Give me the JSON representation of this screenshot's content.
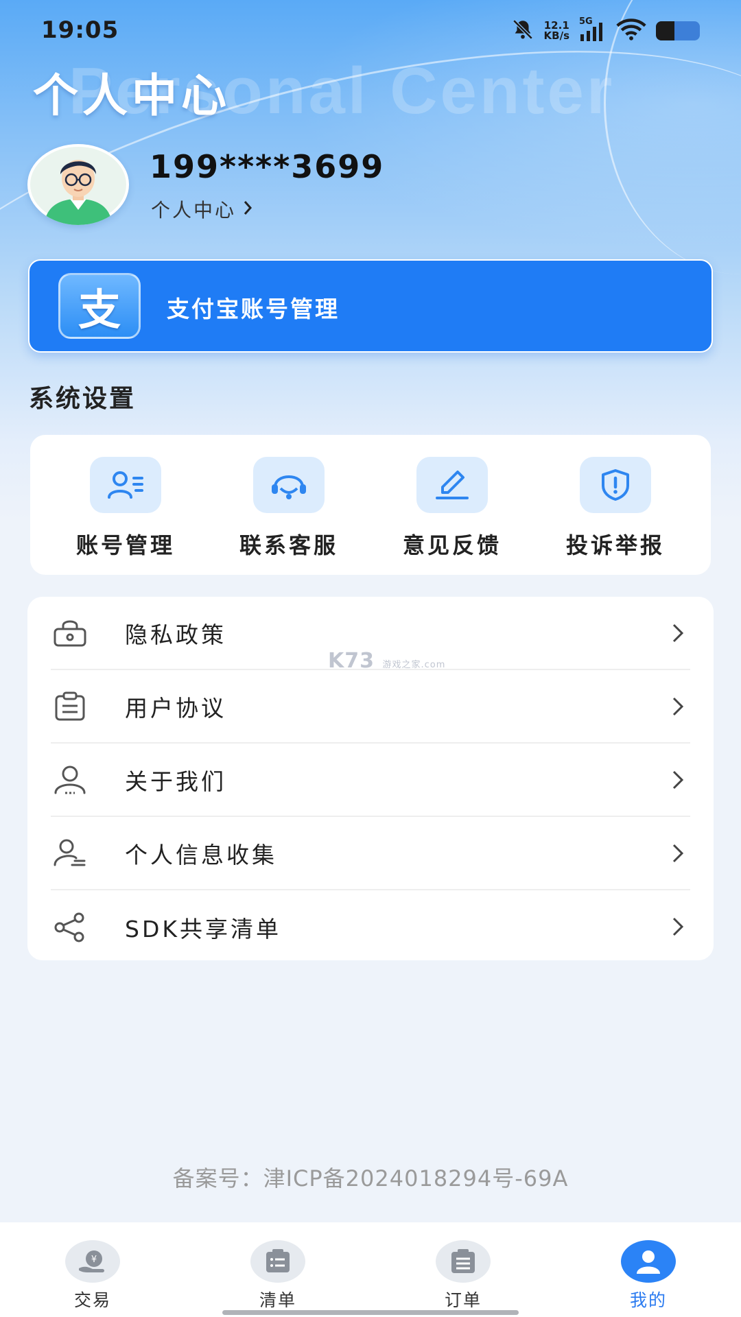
{
  "status_bar": {
    "time": "19:05",
    "net_speed_value": "12.1",
    "net_speed_unit": "KB/s",
    "network": "5G",
    "icons": [
      "bell-muted-icon",
      "signal-icon",
      "wifi-icon",
      "battery-icon"
    ],
    "battery_level": 0.42
  },
  "header": {
    "title": "个人中心",
    "watermark": "Personal Center"
  },
  "profile": {
    "phone": "199****3699",
    "link_label": "个人中心"
  },
  "alipay": {
    "label": "支付宝账号管理",
    "icon_char": "支"
  },
  "settings": {
    "section_title": "系统设置",
    "items": [
      {
        "label": "账号管理",
        "icon": "account-manage-icon"
      },
      {
        "label": "联系客服",
        "icon": "headset-icon"
      },
      {
        "label": "意见反馈",
        "icon": "pen-icon"
      },
      {
        "label": "投诉举报",
        "icon": "shield-alert-icon"
      }
    ]
  },
  "menu": {
    "items": [
      {
        "label": "隐私政策",
        "icon": "lock-icon"
      },
      {
        "label": "用户协议",
        "icon": "clipboard-icon"
      },
      {
        "label": "关于我们",
        "icon": "user-group-icon"
      },
      {
        "label": "个人信息收集",
        "icon": "user-info-icon"
      },
      {
        "label": "SDK共享清单",
        "icon": "share-icon"
      }
    ]
  },
  "watermark_overlay": {
    "brand": "K73",
    "line1": "游戏之家",
    "line2": ".com"
  },
  "footer": {
    "icp": "备案号：津ICP备2024018294号-69A"
  },
  "tabbar": {
    "tabs": [
      {
        "label": "交易",
        "icon": "trade-icon",
        "active": false
      },
      {
        "label": "清单",
        "icon": "list-icon",
        "active": false
      },
      {
        "label": "订单",
        "icon": "order-icon",
        "active": false
      },
      {
        "label": "我的",
        "icon": "profile-icon",
        "active": true
      }
    ]
  },
  "colors": {
    "accent": "#1f7cf5",
    "active_tab": "#2b7bf0",
    "icon_blue": "#2e86f0"
  }
}
